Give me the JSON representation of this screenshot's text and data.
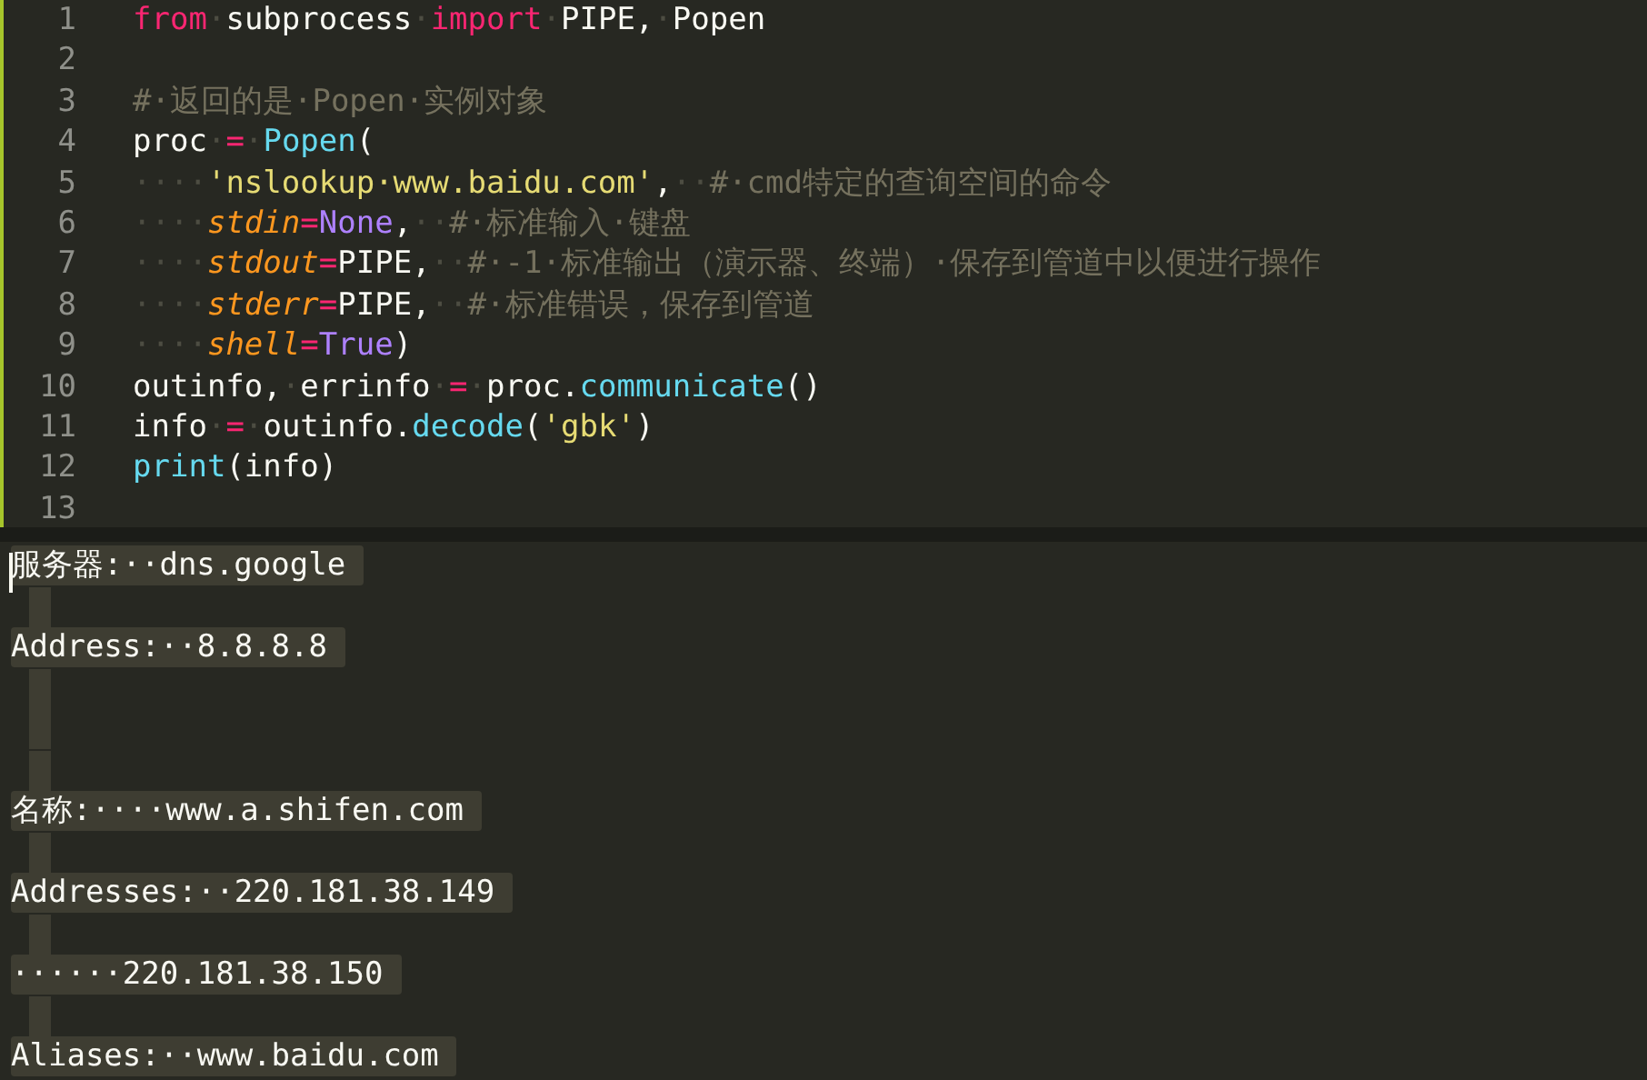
{
  "editor": {
    "lines": [
      {
        "number": "1",
        "tokens": [
          {
            "kind": "keyword",
            "text": "from"
          },
          {
            "kind": "ws",
            "text": "·"
          },
          {
            "kind": "plain",
            "text": "subprocess"
          },
          {
            "kind": "ws",
            "text": "·"
          },
          {
            "kind": "keyword",
            "text": "import"
          },
          {
            "kind": "ws",
            "text": "·"
          },
          {
            "kind": "plain",
            "text": "PIPE,"
          },
          {
            "kind": "ws",
            "text": "·"
          },
          {
            "kind": "plain",
            "text": "Popen"
          }
        ]
      },
      {
        "number": "2"
      },
      {
        "number": "3",
        "tokens": [
          {
            "kind": "comment",
            "text": "#·返回的是·Popen·实例对象"
          }
        ]
      },
      {
        "number": "4",
        "tokens": [
          {
            "kind": "plain",
            "text": "proc"
          },
          {
            "kind": "ws",
            "text": "·"
          },
          {
            "kind": "keyword",
            "text": "="
          },
          {
            "kind": "ws",
            "text": "·"
          },
          {
            "kind": "func",
            "text": "Popen"
          },
          {
            "kind": "plain",
            "text": "("
          }
        ]
      },
      {
        "number": "5",
        "tokens": [
          {
            "kind": "ws",
            "text": "····"
          },
          {
            "kind": "string",
            "text": "'nslookup·www.baidu.com'"
          },
          {
            "kind": "plain",
            "text": ","
          },
          {
            "kind": "ws",
            "text": "··"
          },
          {
            "kind": "comment",
            "text": "#·cmd特定的查询空间的命令"
          }
        ]
      },
      {
        "number": "6",
        "tokens": [
          {
            "kind": "ws",
            "text": "····"
          },
          {
            "kind": "param",
            "text": "stdin"
          },
          {
            "kind": "keyword",
            "text": "="
          },
          {
            "kind": "const",
            "text": "None"
          },
          {
            "kind": "plain",
            "text": ","
          },
          {
            "kind": "ws",
            "text": "··"
          },
          {
            "kind": "comment",
            "text": "#·标准输入·键盘"
          }
        ]
      },
      {
        "number": "7",
        "tokens": [
          {
            "kind": "ws",
            "text": "····"
          },
          {
            "kind": "param",
            "text": "stdout"
          },
          {
            "kind": "keyword",
            "text": "="
          },
          {
            "kind": "plain",
            "text": "PIPE,"
          },
          {
            "kind": "ws",
            "text": "··"
          },
          {
            "kind": "comment",
            "text": "#·-1·标准输出（演示器、终端）·保存到管道中以便进行操作"
          }
        ]
      },
      {
        "number": "8",
        "tokens": [
          {
            "kind": "ws",
            "text": "····"
          },
          {
            "kind": "param",
            "text": "stderr"
          },
          {
            "kind": "keyword",
            "text": "="
          },
          {
            "kind": "plain",
            "text": "PIPE,"
          },
          {
            "kind": "ws",
            "text": "··"
          },
          {
            "kind": "comment",
            "text": "#·标准错误，保存到管道"
          }
        ]
      },
      {
        "number": "9",
        "tokens": [
          {
            "kind": "ws",
            "text": "····"
          },
          {
            "kind": "param",
            "text": "shell"
          },
          {
            "kind": "keyword",
            "text": "="
          },
          {
            "kind": "const",
            "text": "True"
          },
          {
            "kind": "plain",
            "text": ")"
          }
        ]
      },
      {
        "number": "10",
        "tokens": [
          {
            "kind": "plain",
            "text": "outinfo,"
          },
          {
            "kind": "ws",
            "text": "·"
          },
          {
            "kind": "plain",
            "text": "errinfo"
          },
          {
            "kind": "ws",
            "text": "·"
          },
          {
            "kind": "keyword",
            "text": "="
          },
          {
            "kind": "ws",
            "text": "·"
          },
          {
            "kind": "plain",
            "text": "proc."
          },
          {
            "kind": "func",
            "text": "communicate"
          },
          {
            "kind": "plain",
            "text": "()"
          }
        ]
      },
      {
        "number": "11",
        "tokens": [
          {
            "kind": "plain",
            "text": "info"
          },
          {
            "kind": "ws",
            "text": "·"
          },
          {
            "kind": "keyword",
            "text": "="
          },
          {
            "kind": "ws",
            "text": "·"
          },
          {
            "kind": "plain",
            "text": "outinfo."
          },
          {
            "kind": "func",
            "text": "decode"
          },
          {
            "kind": "plain",
            "text": "("
          },
          {
            "kind": "string",
            "text": "'gbk'"
          },
          {
            "kind": "plain",
            "text": ")"
          }
        ]
      },
      {
        "number": "12",
        "tokens": [
          {
            "kind": "func",
            "text": "print"
          },
          {
            "kind": "plain",
            "text": "(info)"
          }
        ]
      },
      {
        "number": "13"
      }
    ]
  },
  "output": {
    "lines": [
      {
        "kind": "text",
        "text": "服务器:··dns.google"
      },
      {
        "kind": "blank"
      },
      {
        "kind": "text",
        "text": "Address:··8.8.8.8"
      },
      {
        "kind": "blank"
      },
      {
        "kind": "blank"
      },
      {
        "kind": "blank"
      },
      {
        "kind": "text",
        "text": "名称:····www.a.shifen.com"
      },
      {
        "kind": "blank"
      },
      {
        "kind": "text",
        "text": "Addresses:··220.181.38.149"
      },
      {
        "kind": "blank"
      },
      {
        "kind": "text",
        "text": "······220.181.38.150"
      },
      {
        "kind": "blank"
      },
      {
        "kind": "text",
        "text": "Aliases:··www.baidu.com"
      }
    ]
  }
}
